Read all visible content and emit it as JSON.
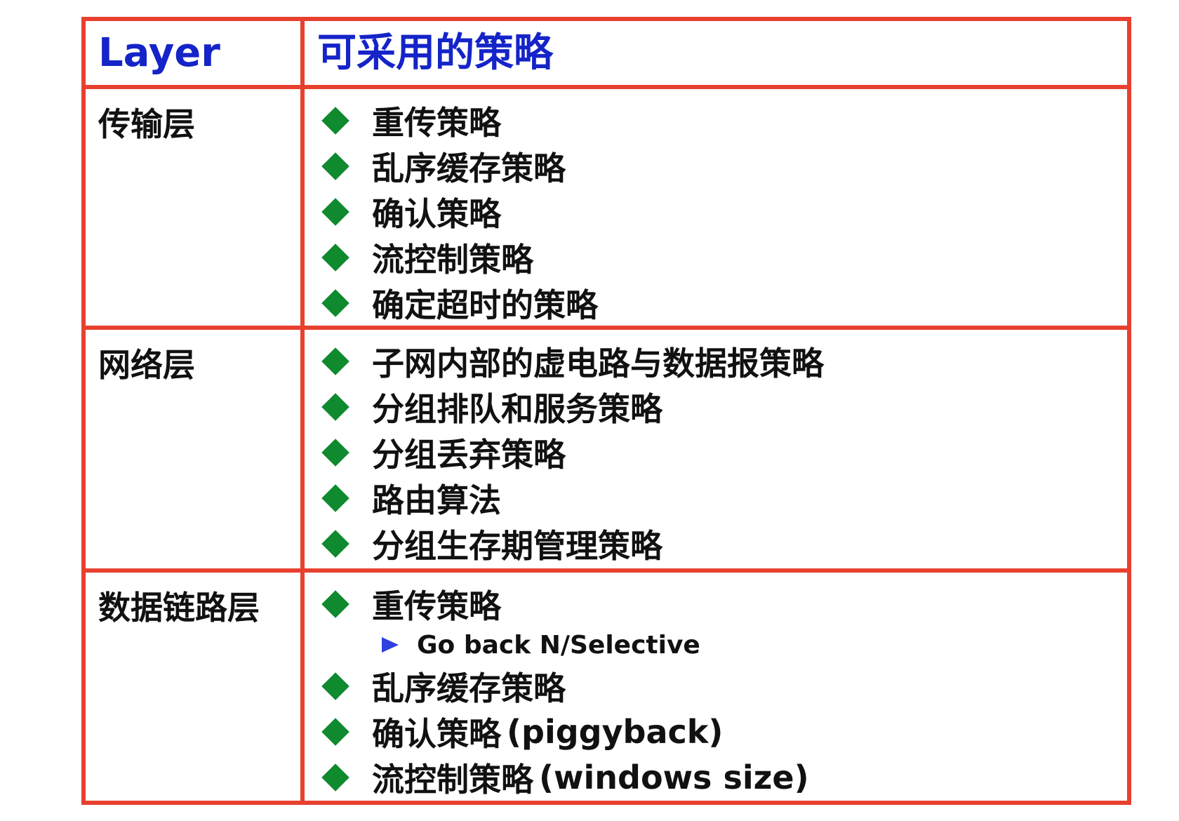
{
  "header": {
    "layer_label": "Layer",
    "strategy_label": "可采用的策略"
  },
  "rows": [
    {
      "layer": "传输层",
      "items": [
        {
          "text": "重传策略",
          "latin": ""
        },
        {
          "text": "乱序缓存策略",
          "latin": ""
        },
        {
          "text": "确认策略",
          "latin": ""
        },
        {
          "text": "流控制策略",
          "latin": ""
        },
        {
          "text": "确定超时的策略",
          "latin": ""
        }
      ]
    },
    {
      "layer": "网络层",
      "items": [
        {
          "text": "子网内部的虚电路与数据报策略",
          "latin": ""
        },
        {
          "text": "分组排队和服务策略",
          "latin": ""
        },
        {
          "text": "分组丢弃策略",
          "latin": ""
        },
        {
          "text": "路由算法",
          "latin": ""
        },
        {
          "text": "分组生存期管理策略",
          "latin": ""
        }
      ]
    },
    {
      "layer": "数据链路层",
      "items": [
        {
          "text": "重传策略",
          "latin": "",
          "sub": "Go back N/Selective"
        },
        {
          "text": "乱序缓存策略",
          "latin": ""
        },
        {
          "text": "确认策略",
          "latin": "(piggyback)"
        },
        {
          "text": "流控制策略",
          "latin": "(windows size)"
        }
      ]
    }
  ],
  "colors": {
    "border": "#e8402f",
    "header_text": "#1524c8",
    "bullet": "#0f8a2e",
    "sub_bullet": "#2f3fe0"
  },
  "icons": {
    "bullet": "green-diamond-icon",
    "sub_bullet": "blue-arrowhead-icon"
  }
}
